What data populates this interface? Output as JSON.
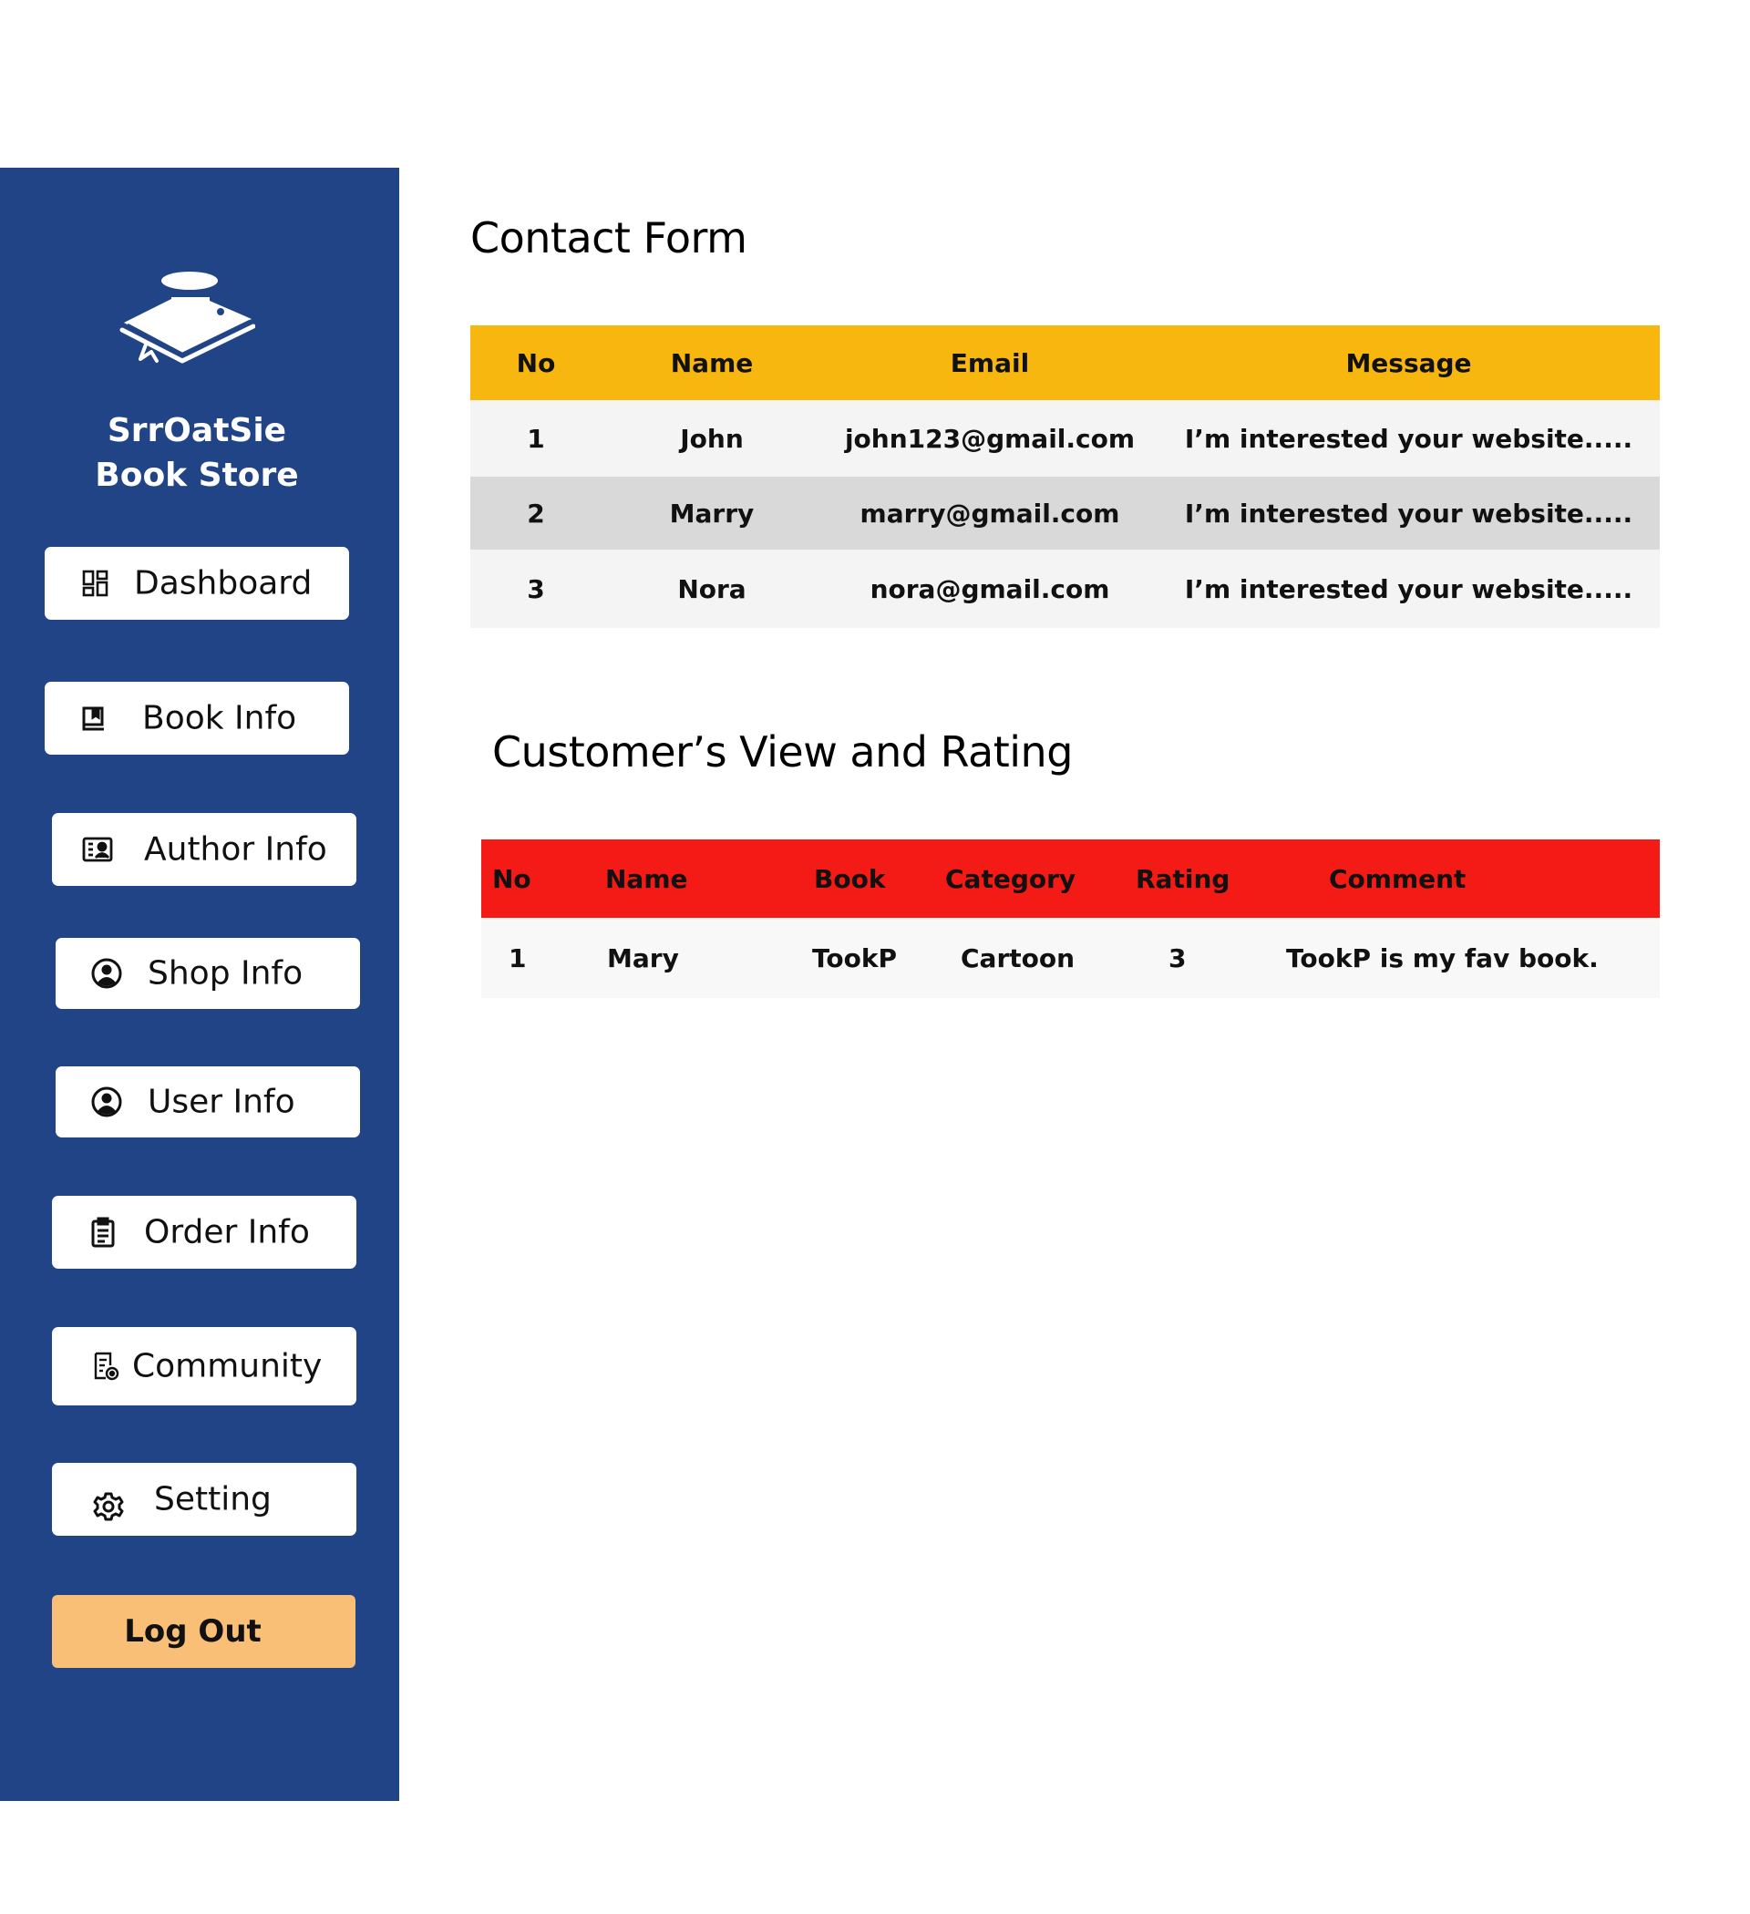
{
  "brand": {
    "line1": "SrrOatSie",
    "line2": "Book Store",
    "logo_icon": "book-with-hat-icon"
  },
  "sidebar": {
    "background": "#214487",
    "items": [
      {
        "label": "Dashboard",
        "icon": "dashboard-icon"
      },
      {
        "label": "Book Info",
        "icon": "book-icon"
      },
      {
        "label": "Author Info",
        "icon": "id-card-icon"
      },
      {
        "label": "Shop Info",
        "icon": "user-circle-icon"
      },
      {
        "label": "User Info",
        "icon": "user-circle-icon"
      },
      {
        "label": "Order Info",
        "icon": "clipboard-icon"
      },
      {
        "label": "Community",
        "icon": "document-settings-icon"
      },
      {
        "label": "Setting",
        "icon": "gear-icon"
      }
    ],
    "logout": {
      "label": "Log Out",
      "color": "#f9bf77"
    }
  },
  "contact": {
    "title": "Contact Form",
    "header_color": "#f8b70e",
    "columns": [
      "No",
      "Name",
      "Email",
      "Message"
    ],
    "rows": [
      [
        "1",
        "John",
        "john123@gmail.com",
        "I’m interested your website....."
      ],
      [
        "2",
        "Marry",
        "marry@gmail.com",
        "I’m interested your website....."
      ],
      [
        "3",
        "Nora",
        "nora@gmail.com",
        "I’m interested your website....."
      ]
    ]
  },
  "ratings": {
    "title": "Customer’s View and Rating",
    "header_color": "#f41a16",
    "columns": [
      "No",
      "Name",
      "Book",
      "Category",
      "Rating",
      "Comment"
    ],
    "rows": [
      [
        "1",
        "Mary",
        "TookP",
        "Cartoon",
        "3",
        "TookP is my fav book."
      ]
    ]
  }
}
